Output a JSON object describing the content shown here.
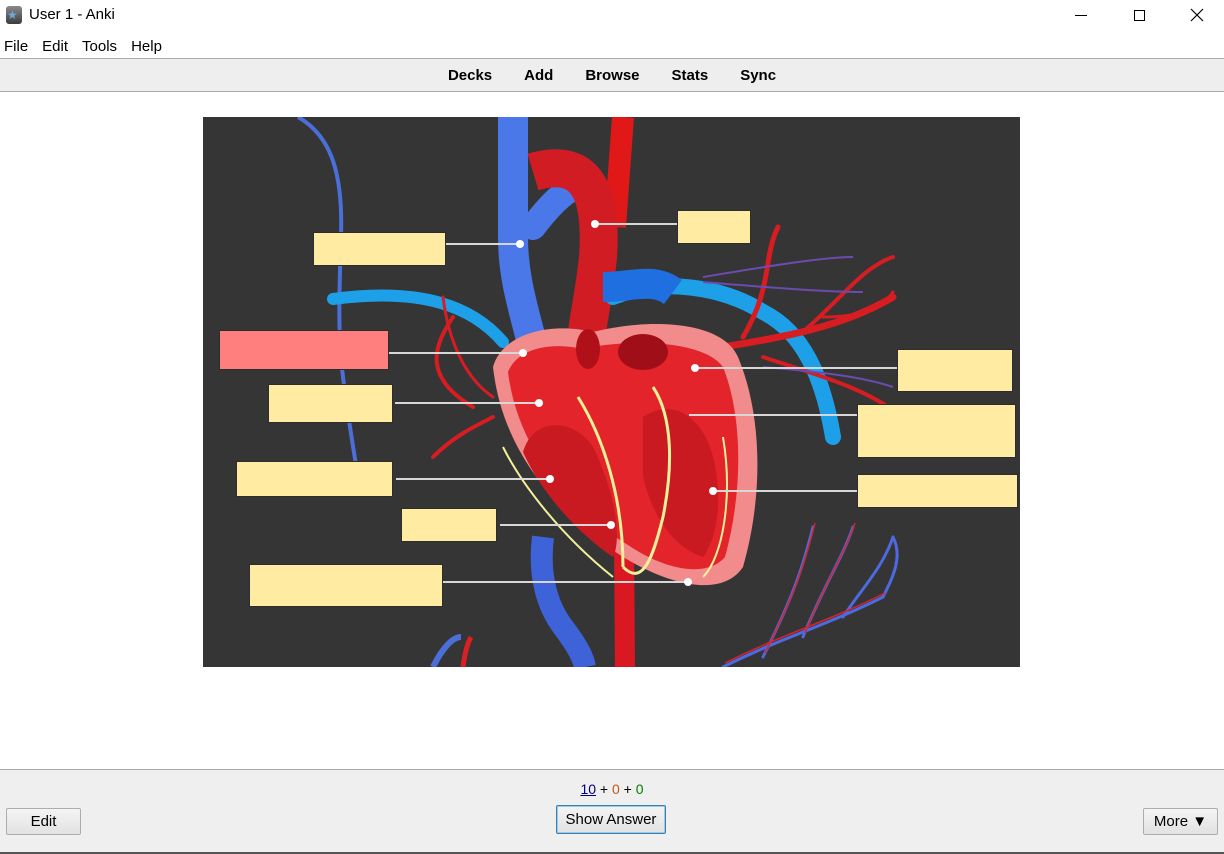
{
  "window": {
    "title": "User 1 - Anki",
    "icon": "anki-star-icon",
    "controls": [
      "minimize-icon",
      "maximize-icon",
      "close-icon"
    ]
  },
  "menu": [
    "File",
    "Edit",
    "Tools",
    "Help"
  ],
  "toolbar": [
    "Decks",
    "Add",
    "Browse",
    "Stats",
    "Sync"
  ],
  "card": {
    "image": "heart-anatomy-diagram",
    "occlusion_masks": {
      "total": 11,
      "active_index": 1,
      "active_color": "#ff7e7e",
      "inactive_color": "#ffeba2"
    }
  },
  "bottom": {
    "counts": {
      "new": "10",
      "sep1": " + ",
      "learning": "0",
      "sep2": " + ",
      "review": "0"
    },
    "edit_label": "Edit",
    "show_answer_label": "Show Answer",
    "more_label": "More ▼"
  },
  "colors": {
    "new_count": "#000080",
    "learning_count": "#c35617",
    "review_count": "#008000"
  }
}
